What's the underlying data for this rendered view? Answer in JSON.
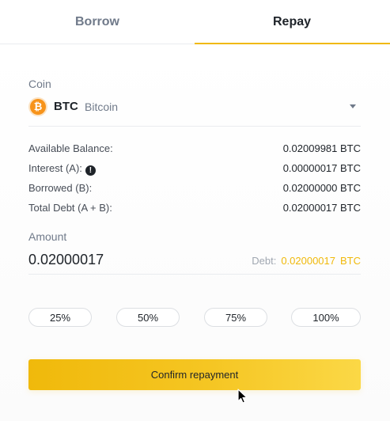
{
  "tabs": {
    "borrow": "Borrow",
    "repay": "Repay",
    "active": "repay"
  },
  "coin": {
    "label": "Coin",
    "symbol": "BTC",
    "name": "Bitcoin",
    "icon_glyph": "₿",
    "icon": "bitcoin-icon"
  },
  "details": [
    {
      "label": "Available Balance:",
      "value": "0.02009981 BTC"
    },
    {
      "label": "Interest (A):",
      "value": "0.00000017 BTC",
      "info_glyph": "!"
    },
    {
      "label": "Borrowed (B):",
      "value": "0.02000000 BTC"
    },
    {
      "label": "Total Debt (A + B):",
      "value": "0.02000017 BTC"
    }
  ],
  "amount": {
    "label": "Amount",
    "value": "0.02000017",
    "debt_label": "Debt:",
    "debt_value": "0.02000017",
    "debt_unit": "BTC"
  },
  "percent_buttons": [
    "25%",
    "50%",
    "75%",
    "100%"
  ],
  "confirm": {
    "label": "Confirm repayment"
  },
  "colors": {
    "accent": "#f0b90b",
    "btc": "#f7931a",
    "text": "#1e2329",
    "muted": "#707a8a"
  }
}
